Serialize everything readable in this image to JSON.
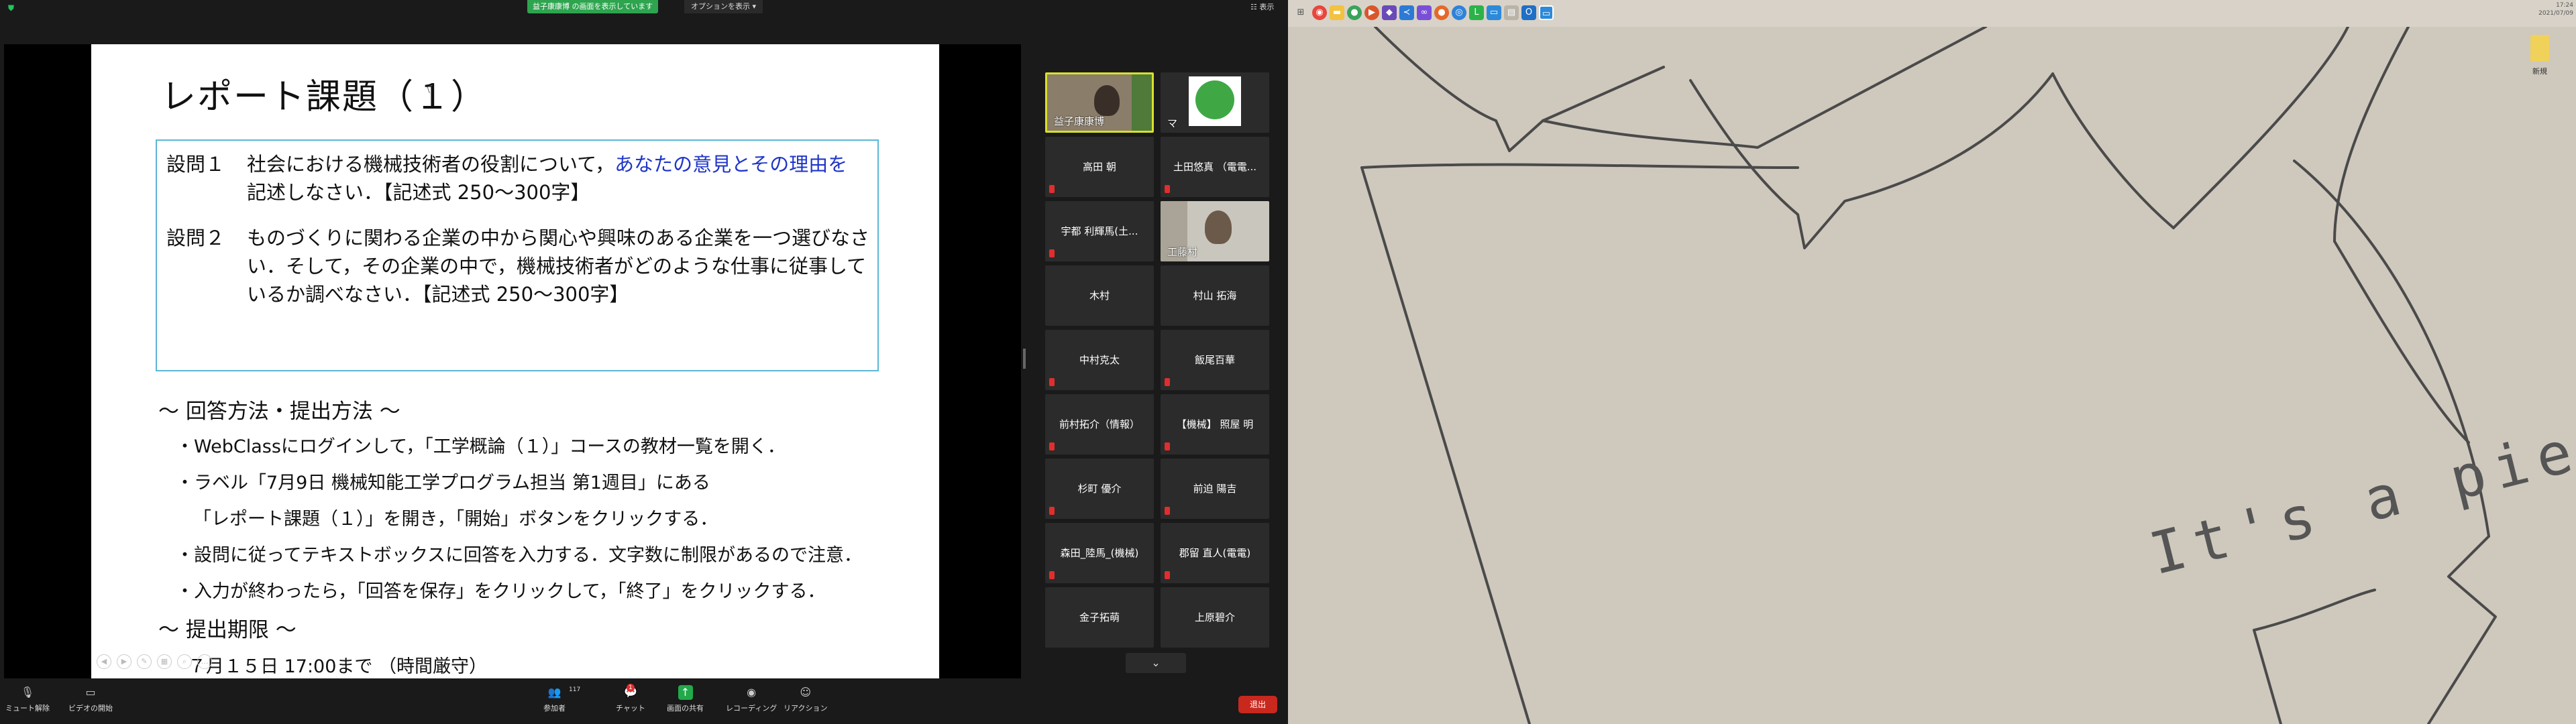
{
  "zoom": {
    "banner": "益子康康博 の画面を表示しています",
    "options_label": "オプションを表示",
    "view_label": "表示",
    "slide": {
      "title": "レポート課題（１）",
      "q1_num": "設問１",
      "q1_body_a": "社会における機械技術者の役割について，",
      "q1_body_hl": "あなたの意見とその理由を",
      "q1_body_b": "記述しなさい．【記述式  250〜300字】",
      "q2_num": "設問２",
      "q2_body": "ものづくりに関わる企業の中から関心や興味のある企業を一つ選びなさい．そして，その企業の中で，機械技術者がどのような仕事に従事しているか調べなさい．【記述式  250〜300字】",
      "sec1": "〜 回答方法・提出方法 〜",
      "items": [
        "・WebClassにログインして，「工学概論（１）」コースの教材一覧を開く．",
        "・ラベル「7月9日 機械知能工学プログラム担当 第1週目」にある",
        "「レポート課題（１）」を開き，「開始」ボタンをクリックする．",
        "・設問に従ってテキストボックスに回答を入力する．文字数に制限があるので注意．",
        "・入力が終わったら，「回答を保存」をクリックして，「終了」をクリックする．"
      ],
      "sec2": "〜 提出期限 〜",
      "deadline": "７月１５日 17:00まで  （時間厳守）"
    },
    "participants": [
      {
        "name": "益子康康博",
        "video": true
      },
      {
        "name": "マ     ",
        "video": true
      },
      {
        "name": "高田 朝",
        "video": false
      },
      {
        "name": "土田悠真 （電電...",
        "video": false
      },
      {
        "name": "宇都  利輝馬(土...",
        "video": false
      },
      {
        "name": "工藤村",
        "video": true
      },
      {
        "name": "木村",
        "video": false
      },
      {
        "name": "村山  拓海",
        "video": false
      },
      {
        "name": "中村克太",
        "video": false
      },
      {
        "name": "飯尾百華",
        "video": false
      },
      {
        "name": "前村拓介（情報）",
        "video": false
      },
      {
        "name": "【機械】 照屋  明",
        "video": false
      },
      {
        "name": "杉町 優介",
        "video": false
      },
      {
        "name": "前迫 陽吉",
        "video": false
      },
      {
        "name": "森田_陸馬_(機械)",
        "video": false
      },
      {
        "name": "郡留 直人(電電)",
        "video": false
      },
      {
        "name": "金子拓萌",
        "video": false
      },
      {
        "name": "上原碧介",
        "video": false
      }
    ],
    "toolbar": {
      "mute": "ミュート解除",
      "video": "ビデオの開始",
      "participants": "参加者",
      "participants_count": "117",
      "chat": "チャット",
      "chat_badge": "1",
      "share": "画面の共有",
      "record": "レコーディング",
      "reactions": "リアクション",
      "end": "退出"
    }
  },
  "desktop": {
    "clock_time": "17:24",
    "clock_date": "2021/07/09",
    "icon_label": "新規",
    "wallpaper_text": "It's a piece of cake！"
  }
}
